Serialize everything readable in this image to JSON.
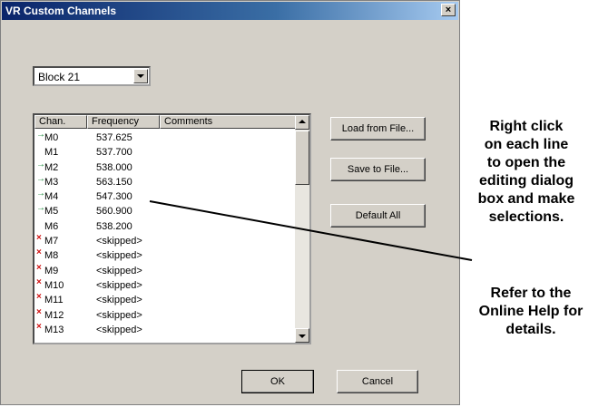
{
  "window": {
    "title": "VR Custom Channels",
    "close_glyph": "×"
  },
  "block_select": {
    "value": "Block 21"
  },
  "list": {
    "columns": [
      "Chan.",
      "Frequency",
      "Comments"
    ],
    "rows": [
      {
        "mark": "arrow",
        "chan": "M0",
        "freq": "537.625"
      },
      {
        "mark": "",
        "chan": "M1",
        "freq": "537.700"
      },
      {
        "mark": "arrow",
        "chan": "M2",
        "freq": "538.000"
      },
      {
        "mark": "arrow",
        "chan": "M3",
        "freq": "563.150"
      },
      {
        "mark": "arrow",
        "chan": "M4",
        "freq": "547.300"
      },
      {
        "mark": "arrow",
        "chan": "M5",
        "freq": "560.900"
      },
      {
        "mark": "",
        "chan": "M6",
        "freq": "538.200"
      },
      {
        "mark": "cross",
        "chan": "M7",
        "freq": "<skipped>"
      },
      {
        "mark": "cross",
        "chan": "M8",
        "freq": "<skipped>"
      },
      {
        "mark": "cross",
        "chan": "M9",
        "freq": "<skipped>"
      },
      {
        "mark": "cross",
        "chan": "M10",
        "freq": "<skipped>"
      },
      {
        "mark": "cross",
        "chan": "M11",
        "freq": "<skipped>"
      },
      {
        "mark": "cross",
        "chan": "M12",
        "freq": "<skipped>"
      },
      {
        "mark": "cross",
        "chan": "M13",
        "freq": "<skipped>"
      }
    ],
    "mark_glyphs": {
      "arrow": "→",
      "cross": "×"
    },
    "mark_colors": {
      "arrow": "#1a8a3a",
      "cross": "#d01010"
    }
  },
  "buttons": {
    "load": "Load from File...",
    "save": "Save to File...",
    "default": "Default All",
    "ok": "OK",
    "cancel": "Cancel"
  },
  "callout": {
    "lines": [
      "Right click",
      "on each line",
      "to open the",
      "editing dialog",
      "box and make",
      "selections."
    ],
    "help_lines": [
      "Refer to the",
      "Online Help for",
      "details."
    ]
  },
  "colors": {
    "titlebar_start": "#0a246a",
    "face": "#d4d0c8"
  }
}
